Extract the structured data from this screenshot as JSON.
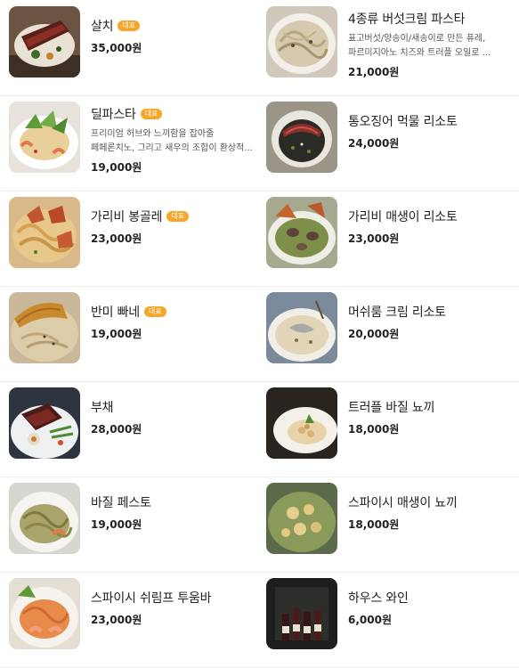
{
  "menu": {
    "badge_label": "대표",
    "left": [
      {
        "name": "살치",
        "badge": true,
        "price": "35,000원",
        "desc": ""
      },
      {
        "name": "딜파스타",
        "badge": true,
        "price": "19,000원",
        "desc": "프리미엄 허브와 느끼함을 잡아줄 페페론치노, 그리고 새우의 조합이 환상적..."
      },
      {
        "name": "가리비 봉골레",
        "badge": true,
        "price": "23,000원",
        "desc": ""
      },
      {
        "name": "반미 빠네",
        "badge": true,
        "price": "19,000원",
        "desc": ""
      },
      {
        "name": "부채",
        "badge": false,
        "price": "28,000원",
        "desc": ""
      },
      {
        "name": "바질 페스토",
        "badge": false,
        "price": "19,000원",
        "desc": ""
      },
      {
        "name": "스파이시 쉬림프 투움바",
        "badge": false,
        "price": "23,000원",
        "desc": ""
      }
    ],
    "right": [
      {
        "name": "4종류 버섯크림 파스타",
        "badge": false,
        "price": "21,000원",
        "desc": "표고버섯/양송이/새송이로 만든 퓨레, 파르미지아노 치즈와 트러플 오일로 ..."
      },
      {
        "name": "통오징어 먹물 리소토",
        "badge": false,
        "price": "24,000원",
        "desc": ""
      },
      {
        "name": "가리비 매생이 리소토",
        "badge": false,
        "price": "23,000원",
        "desc": ""
      },
      {
        "name": "머쉬룸 크림 리소토",
        "badge": false,
        "price": "20,000원",
        "desc": ""
      },
      {
        "name": "트러플 바질 뇨끼",
        "badge": false,
        "price": "18,000원",
        "desc": ""
      },
      {
        "name": "스파이시 매생이 뇨끼",
        "badge": false,
        "price": "18,000원",
        "desc": ""
      },
      {
        "name": "하우스 와인",
        "badge": false,
        "price": "6,000원",
        "desc": ""
      }
    ]
  },
  "colors": {
    "badge": "#f6a72b",
    "divider": "#efefef"
  }
}
